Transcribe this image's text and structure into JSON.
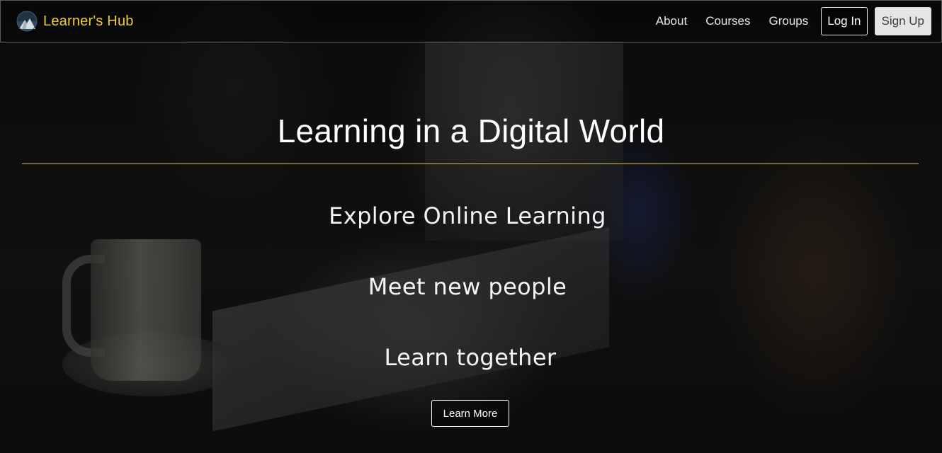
{
  "navbar": {
    "brand": {
      "name": "Learner's Hub",
      "logo_icon": "mountain-logo-icon"
    },
    "links": [
      {
        "label": "About"
      },
      {
        "label": "Courses"
      },
      {
        "label": "Groups"
      }
    ],
    "login_label": "Log In",
    "signup_label": "Sign Up"
  },
  "hero": {
    "title": "Learning in a Digital World",
    "lines": [
      "Explore Online Learning",
      "Meet new people",
      "Learn together"
    ],
    "cta_label": "Learn More"
  },
  "colors": {
    "brand": "#f2cd3a",
    "divider": "#d8c24a",
    "text": "#ffffff",
    "signup_bg": "#e5e5e5"
  }
}
